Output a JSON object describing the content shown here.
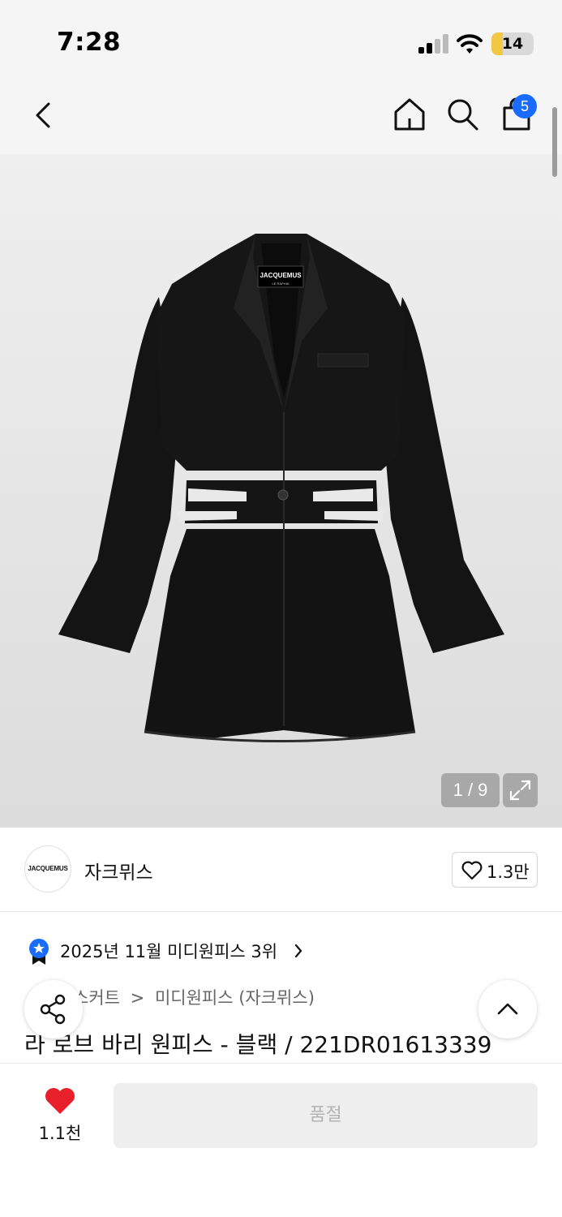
{
  "status_bar": {
    "time": "7:28",
    "battery_level": "14"
  },
  "nav": {
    "cart_count": "5"
  },
  "gallery": {
    "counter": "1 / 9",
    "garment_label_top": "JACQUEMUS",
    "garment_label_bottom": "LE RAPHIA"
  },
  "brand": {
    "logo_text": "JACQUEMUS",
    "name": "자크뮈스",
    "like_count": "1.3만"
  },
  "ranking": {
    "text": "2025년 11월 미디원피스 3위"
  },
  "breadcrumb": {
    "items": [
      "원피스/스커트",
      "미디원피스 (자크뮈스)"
    ],
    "visible_first": "스커트",
    "separator": ">"
  },
  "product": {
    "title": "라 로브 바리 원피스 - 블랙 / 221DR01613339"
  },
  "bottom_bar": {
    "wish_count": "1.1천",
    "soldout_label": "품절"
  },
  "colors": {
    "accent_blue": "#1a6bff",
    "heart_red": "#e8202a",
    "battery_yellow": "#f2c744"
  }
}
